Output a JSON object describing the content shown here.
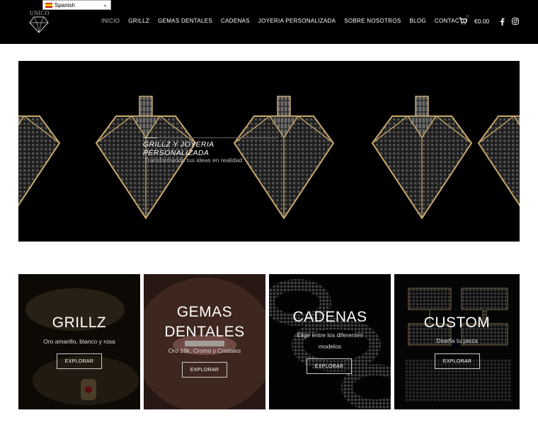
{
  "header": {
    "language": "Spanish",
    "logo_text": "UNICO",
    "nav": [
      {
        "label": "INICIO",
        "active": true
      },
      {
        "label": "GRILLZ"
      },
      {
        "label": "GEMAS DENTALES"
      },
      {
        "label": "CADENAS"
      },
      {
        "label": "JOYERIA PERSONALIZADA"
      },
      {
        "label": "SOBRE NOSOTROS"
      },
      {
        "label": "BLOG"
      },
      {
        "label": "CONTACTO"
      }
    ],
    "cart_count": "0",
    "cart_total": "€0.00",
    "social": [
      "facebook-icon",
      "instagram-icon"
    ]
  },
  "hero": {
    "title": "GRILLZ Y JOYERIA PERSONALIZADA",
    "subtitle": "Transformando tus ideas en realidad"
  },
  "cards": [
    {
      "title": "GRILLZ",
      "subtitle": "Oro amarillo, blanco y rosa",
      "button": "EXPLORAR"
    },
    {
      "title_line1": "GEMAS",
      "title_line2": "DENTALES",
      "subtitle": "Oro 18k, Cromo y Cristales",
      "button": "EXPLORAR"
    },
    {
      "title": "CADENAS",
      "subtitle_line1": "Elige entre los diferentes",
      "subtitle_line2": "modelos",
      "button": "EXPLORAR"
    },
    {
      "title": "CUSTOM",
      "subtitle": "Diseña tu pieza",
      "button": "EXPLORAR"
    }
  ],
  "colors": {
    "header_bg": "#000000",
    "gold": "#c7a86b",
    "page_bg": "#ffffff"
  }
}
